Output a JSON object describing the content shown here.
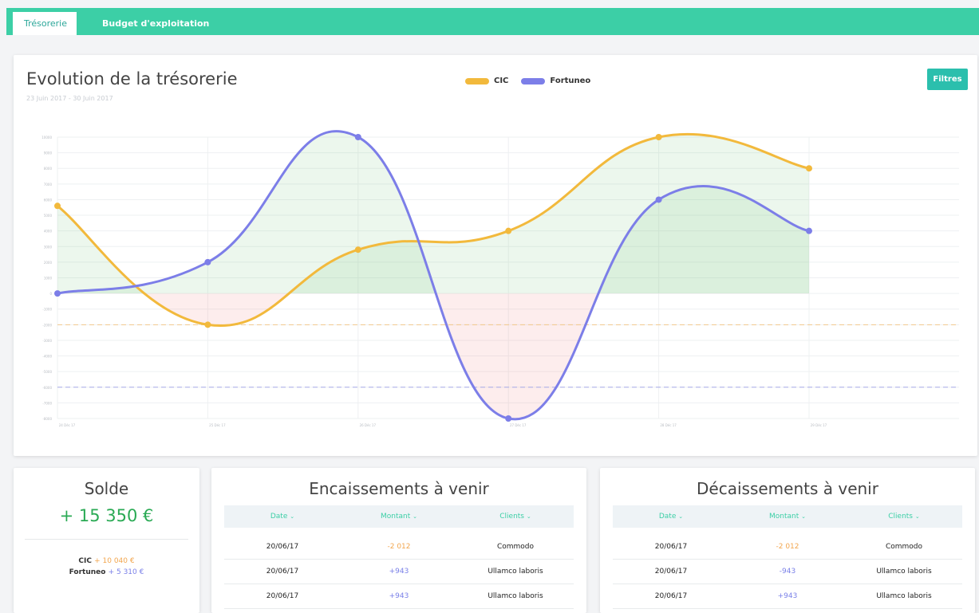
{
  "tabs": [
    {
      "label": "Trésorerie",
      "active": true
    },
    {
      "label": "Budget d'exploitation",
      "active": false
    }
  ],
  "chart": {
    "title": "Evolution de la trésorerie",
    "subtitle": "23 Juin 2017 - 30 Juin 2017",
    "filter_label": "Filtres",
    "legend": [
      {
        "name": "CIC",
        "color": "#f2b93c"
      },
      {
        "name": "Fortuneo",
        "color": "#7c7ee8"
      }
    ]
  },
  "chart_data": {
    "type": "line",
    "x": [
      "24 Déc 17",
      "25 Déc 17",
      "26 Déc 17",
      "27 Déc 17",
      "28 Déc 17",
      "29 Déc 17"
    ],
    "series": [
      {
        "name": "CIC",
        "color": "#f2b93c",
        "values": [
          5600,
          -2000,
          2800,
          4000,
          10000,
          8000
        ]
      },
      {
        "name": "Fortuneo",
        "color": "#7c7ee8",
        "values": [
          0,
          2000,
          10000,
          -8000,
          6000,
          4000
        ]
      }
    ],
    "ylim": [
      -8000,
      10000
    ],
    "reference_lines": [
      -2000,
      -6000
    ],
    "grid": true
  },
  "solde": {
    "title": "Solde",
    "total": "+ 15 350 €",
    "cic_label": "CIC",
    "cic_value": "+ 10 040 €",
    "fortuneo_label": "Fortuneo",
    "fortuneo_value": "+ 5 310 €"
  },
  "encaissements": {
    "title": "Encaissements à venir",
    "columns": [
      "Date",
      "Montant",
      "Clients"
    ],
    "rows": [
      {
        "date": "20/06/17",
        "montant": "-2 012",
        "client": "Commodo"
      },
      {
        "date": "20/06/17",
        "montant": "+943",
        "client": "Ullamco laboris"
      },
      {
        "date": "20/06/17",
        "montant": "+943",
        "client": "Ullamco laboris"
      }
    ]
  },
  "decaissements": {
    "title": "Décaissements à venir",
    "columns": [
      "Date",
      "Montant",
      "Clients"
    ],
    "rows": [
      {
        "date": "20/06/17",
        "montant": "-2 012",
        "client": "Commodo"
      },
      {
        "date": "20/06/17",
        "montant": "-943",
        "client": "Ullamco laboris"
      },
      {
        "date": "20/06/17",
        "montant": "+943",
        "client": "Ullamco laboris"
      }
    ]
  }
}
